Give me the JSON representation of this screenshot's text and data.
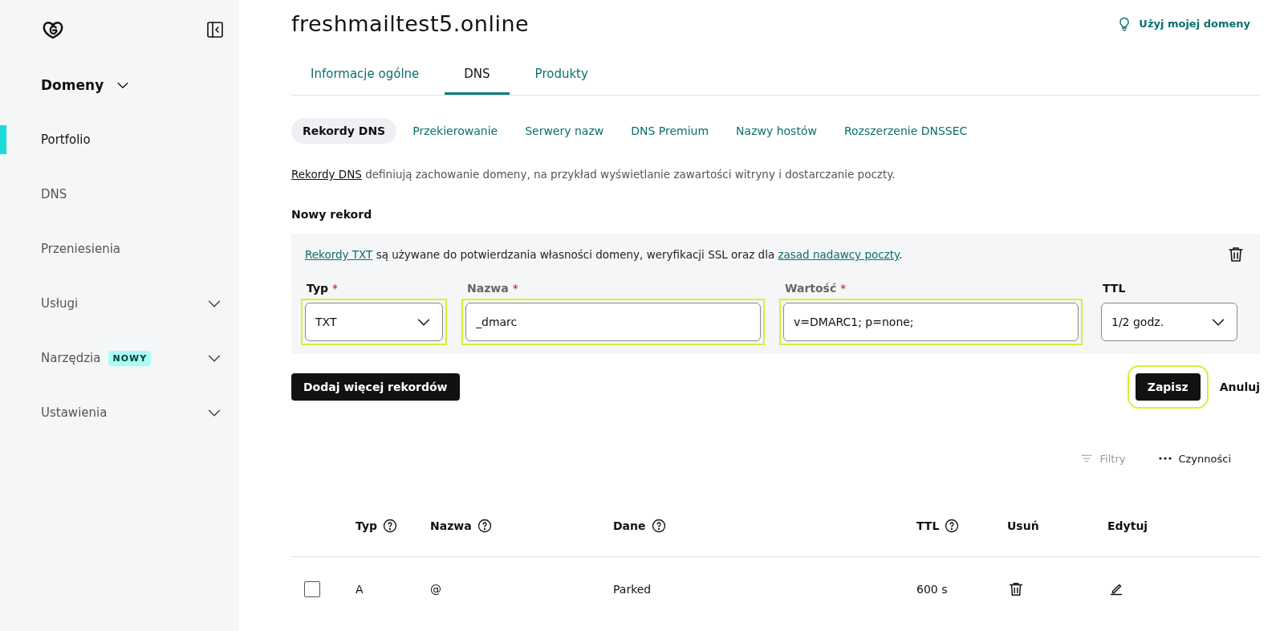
{
  "sidebar": {
    "section": {
      "label": "Domeny",
      "expanded": true
    },
    "items": [
      {
        "label": "Portfolio",
        "selected": true,
        "expandable": false
      },
      {
        "label": "DNS",
        "selected": false,
        "expandable": false
      },
      {
        "label": "Przeniesienia",
        "selected": false,
        "expandable": false
      },
      {
        "label": "Usługi",
        "selected": false,
        "expandable": true
      },
      {
        "label": "Narzędzia",
        "selected": false,
        "expandable": true,
        "badge": "NOWY"
      },
      {
        "label": "Ustawienia",
        "selected": false,
        "expandable": true
      }
    ]
  },
  "header": {
    "title": "freshmailtest5.online",
    "action": "Użyj mojej domeny"
  },
  "tabs": [
    {
      "label": "Informacje ogólne",
      "selected": false
    },
    {
      "label": "DNS",
      "selected": true
    },
    {
      "label": "Produkty",
      "selected": false
    }
  ],
  "subtabs": [
    {
      "label": "Rekordy DNS",
      "selected": true
    },
    {
      "label": "Przekierowanie",
      "selected": false
    },
    {
      "label": "Serwery nazw",
      "selected": false
    },
    {
      "label": "DNS Premium",
      "selected": false
    },
    {
      "label": "Nazwy hostów",
      "selected": false
    },
    {
      "label": "Rozszerzenie DNSSEC",
      "selected": false
    }
  ],
  "description": [
    {
      "kind": "link",
      "text": "Rekordy DNS"
    },
    {
      "kind": "text",
      "text": " definiują zachowanie domeny, na przykład wyświetlanie zawartości witryny i dostarczanie poczty."
    }
  ],
  "new_record": {
    "heading": "Nowy rekord",
    "info": [
      {
        "kind": "link",
        "text": "Rekordy TXT"
      },
      {
        "kind": "text",
        "text": " są używane do potwierdzania własności domeny, weryfikacji SSL oraz dla "
      },
      {
        "kind": "link",
        "text": "zasad nadawcy poczty"
      },
      {
        "kind": "text",
        "text": "."
      }
    ],
    "fields": [
      {
        "kind": "select",
        "label": "Typ",
        "required_mark": "*",
        "value": "TXT",
        "highlighted": true
      },
      {
        "kind": "input",
        "label": "Nazwa",
        "required_mark": "*",
        "value": "_dmarc",
        "highlighted": true
      },
      {
        "kind": "input",
        "label": "Wartość",
        "required_mark": "*",
        "value": "v=DMARC1; p=none;",
        "highlighted": true
      },
      {
        "kind": "select",
        "label": "TTL",
        "value": "1/2 godz.",
        "highlighted": false
      }
    ],
    "add_button": "Dodaj więcej rekordów",
    "save_button": {
      "label": "Zapisz",
      "highlighted": true
    },
    "cancel_button": "Anuluj"
  },
  "toolbar": {
    "filters": {
      "label": "Filtry",
      "disabled": true
    },
    "actions": "Czynności"
  },
  "table": {
    "columns": [
      {
        "label": "Typ",
        "help": true
      },
      {
        "label": "Nazwa",
        "help": true
      },
      {
        "label": "Dane",
        "help": true
      },
      {
        "label": "TTL",
        "help": true
      },
      {
        "label": "Usuń",
        "help": false
      },
      {
        "label": "Edytuj",
        "help": false
      }
    ],
    "rows": [
      {
        "checked": false,
        "type": "A",
        "name": "@",
        "data": "Parked",
        "ttl": "600 s"
      }
    ]
  }
}
